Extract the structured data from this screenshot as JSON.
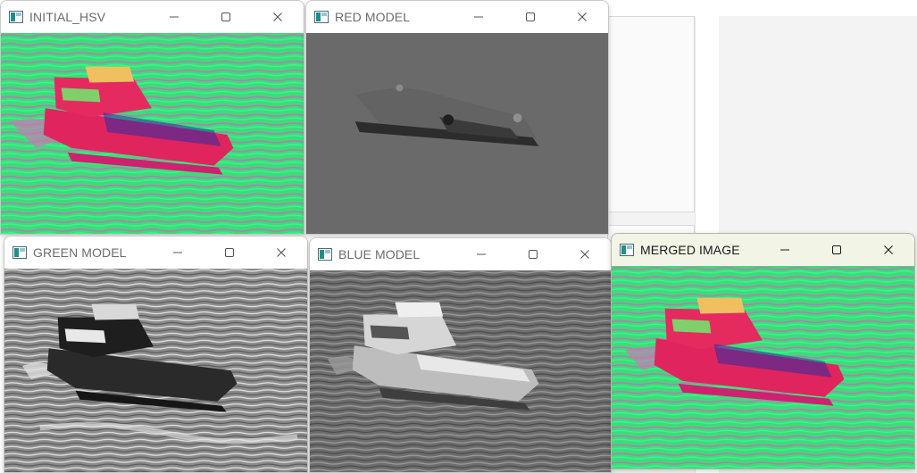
{
  "windows": {
    "initial_hsv": {
      "title": "INITIAL_HSV"
    },
    "red_model": {
      "title": "RED MODEL"
    },
    "green_model": {
      "title": "GREEN MODEL"
    },
    "blue_model": {
      "title": "BLUE MODEL"
    },
    "merged_image": {
      "title": "MERGED IMAGE"
    }
  },
  "window_controls": [
    "minimize-icon",
    "maximize-icon",
    "close-icon"
  ],
  "colors": {
    "hsv_water": "#3ee27a",
    "hsv_boat": "#e0245e",
    "red_model_gray": "#6a6a6a",
    "active_titlebar": "#f2f4e6"
  }
}
